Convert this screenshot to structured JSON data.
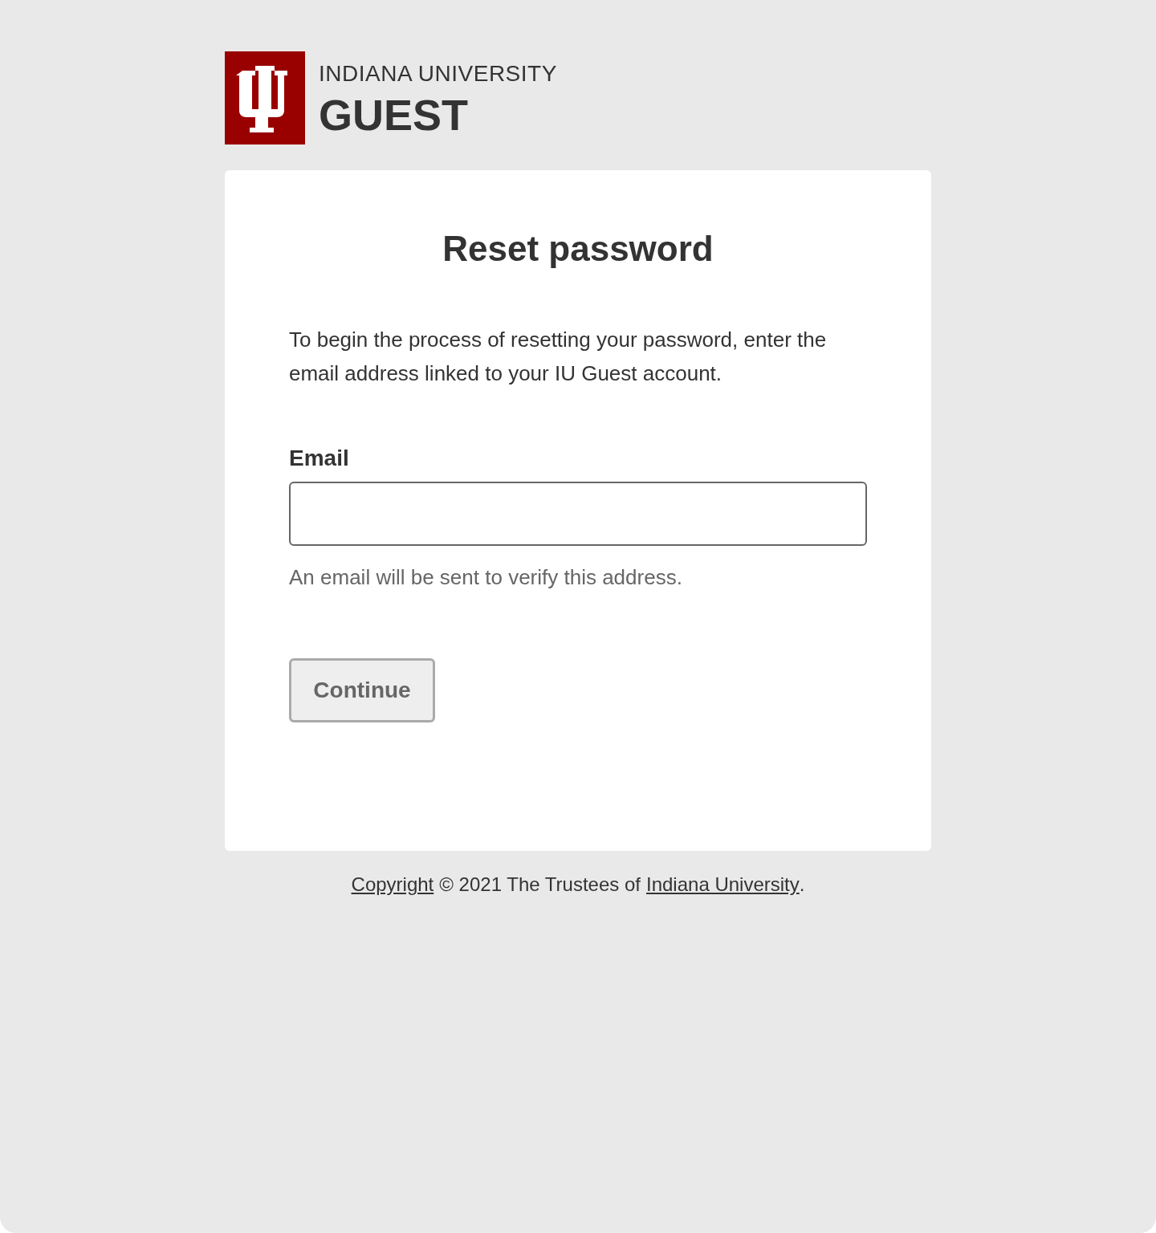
{
  "brand": {
    "institution": "INDIANA UNIVERSITY",
    "product": "GUEST"
  },
  "card": {
    "title": "Reset password",
    "intro": "To begin the process of resetting your password, enter the email address linked to your IU Guest account.",
    "email_field": {
      "label": "Email",
      "help": "An email will be sent to verify this address."
    },
    "button": {
      "label": "Continue",
      "disabled": true
    }
  },
  "footer": {
    "copyright_link": "Copyright",
    "text": "© 2021 The Trustees of",
    "university_link": "Indiana University",
    "end": "."
  }
}
